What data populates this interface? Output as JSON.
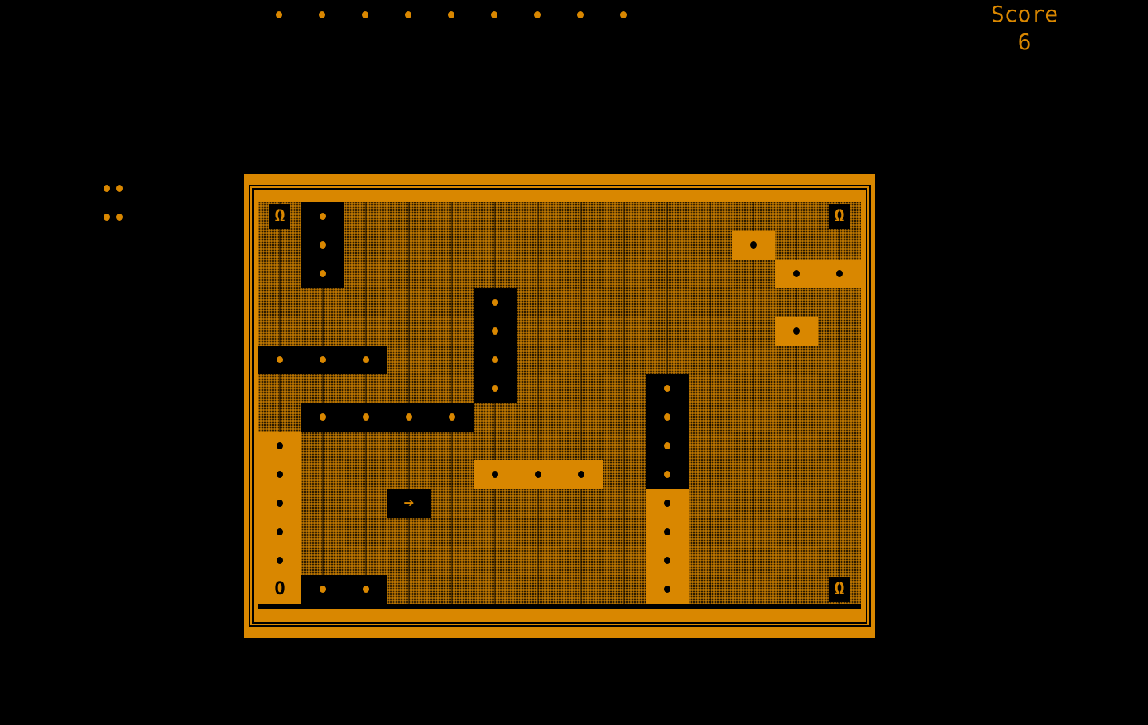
{
  "score": {
    "label": "Score",
    "value": "6"
  },
  "colors": {
    "amber": "#d98700",
    "background": "#000000",
    "fill_dark": "#2a1a00"
  },
  "top_row_dots": 9,
  "lives_remaining": 4,
  "board": {
    "columns": 14,
    "rows": 14,
    "legend": {
      "f": "filled-tile",
      "c": "cleared-path",
      "l": "lit-path"
    },
    "symbols": {
      "dot": "pellet",
      "gate": "Ω",
      "ring": "O",
      "arrow": "➔"
    },
    "tiles": [
      [
        "f",
        "c",
        "f",
        "f",
        "f",
        "f",
        "f",
        "f",
        "f",
        "f",
        "f",
        "f",
        "f",
        "f"
      ],
      [
        "f",
        "c",
        "f",
        "f",
        "f",
        "f",
        "f",
        "f",
        "f",
        "f",
        "f",
        "l",
        "f",
        "f"
      ],
      [
        "f",
        "c",
        "f",
        "f",
        "f",
        "f",
        "f",
        "f",
        "f",
        "f",
        "f",
        "f",
        "l",
        "l"
      ],
      [
        "f",
        "f",
        "f",
        "f",
        "f",
        "c",
        "f",
        "f",
        "f",
        "f",
        "f",
        "f",
        "f",
        "f"
      ],
      [
        "f",
        "f",
        "f",
        "f",
        "f",
        "c",
        "f",
        "f",
        "f",
        "f",
        "f",
        "f",
        "l",
        "f"
      ],
      [
        "c",
        "c",
        "c",
        "f",
        "f",
        "c",
        "f",
        "f",
        "f",
        "f",
        "f",
        "f",
        "f",
        "f"
      ],
      [
        "f",
        "f",
        "f",
        "f",
        "f",
        "c",
        "f",
        "f",
        "f",
        "c",
        "f",
        "f",
        "f",
        "f"
      ],
      [
        "f",
        "c",
        "c",
        "c",
        "c",
        "f",
        "f",
        "f",
        "f",
        "c",
        "f",
        "f",
        "f",
        "f"
      ],
      [
        "l",
        "f",
        "f",
        "f",
        "f",
        "f",
        "f",
        "f",
        "f",
        "c",
        "f",
        "f",
        "f",
        "f"
      ],
      [
        "l",
        "f",
        "f",
        "f",
        "f",
        "l",
        "l",
        "l",
        "f",
        "c",
        "f",
        "f",
        "f",
        "f"
      ],
      [
        "l",
        "f",
        "f",
        "c",
        "f",
        "f",
        "f",
        "f",
        "f",
        "l",
        "f",
        "f",
        "f",
        "f"
      ],
      [
        "l",
        "f",
        "f",
        "f",
        "f",
        "f",
        "f",
        "f",
        "f",
        "l",
        "f",
        "f",
        "f",
        "f"
      ],
      [
        "l",
        "f",
        "f",
        "f",
        "f",
        "f",
        "f",
        "f",
        "f",
        "l",
        "f",
        "f",
        "f",
        "f"
      ],
      [
        "l",
        "c",
        "c",
        "f",
        "f",
        "f",
        "f",
        "f",
        "f",
        "l",
        "f",
        "f",
        "f",
        "f"
      ]
    ],
    "marks": [
      {
        "row": 0,
        "col": 0,
        "type": "gate"
      },
      {
        "row": 0,
        "col": 13,
        "type": "gate"
      },
      {
        "row": 13,
        "col": 13,
        "type": "gate"
      },
      {
        "row": 13,
        "col": 0,
        "type": "ring"
      },
      {
        "row": 10,
        "col": 3,
        "type": "arrow"
      },
      {
        "row": 0,
        "col": 1,
        "type": "dot"
      },
      {
        "row": 1,
        "col": 1,
        "type": "dot"
      },
      {
        "row": 2,
        "col": 1,
        "type": "dot"
      },
      {
        "row": 1,
        "col": 11,
        "type": "dot"
      },
      {
        "row": 2,
        "col": 12,
        "type": "dot"
      },
      {
        "row": 2,
        "col": 13,
        "type": "dot"
      },
      {
        "row": 3,
        "col": 5,
        "type": "dot"
      },
      {
        "row": 4,
        "col": 5,
        "type": "dot"
      },
      {
        "row": 5,
        "col": 5,
        "type": "dot"
      },
      {
        "row": 6,
        "col": 5,
        "type": "dot"
      },
      {
        "row": 4,
        "col": 12,
        "type": "dot"
      },
      {
        "row": 5,
        "col": 0,
        "type": "dot"
      },
      {
        "row": 5,
        "col": 1,
        "type": "dot"
      },
      {
        "row": 5,
        "col": 2,
        "type": "dot"
      },
      {
        "row": 6,
        "col": 9,
        "type": "dot"
      },
      {
        "row": 7,
        "col": 9,
        "type": "dot"
      },
      {
        "row": 8,
        "col": 9,
        "type": "dot"
      },
      {
        "row": 9,
        "col": 9,
        "type": "dot"
      },
      {
        "row": 7,
        "col": 1,
        "type": "dot"
      },
      {
        "row": 7,
        "col": 2,
        "type": "dot"
      },
      {
        "row": 7,
        "col": 3,
        "type": "dot"
      },
      {
        "row": 7,
        "col": 4,
        "type": "dot"
      },
      {
        "row": 8,
        "col": 0,
        "type": "dot"
      },
      {
        "row": 9,
        "col": 0,
        "type": "dot"
      },
      {
        "row": 10,
        "col": 0,
        "type": "dot"
      },
      {
        "row": 11,
        "col": 0,
        "type": "dot"
      },
      {
        "row": 12,
        "col": 0,
        "type": "dot"
      },
      {
        "row": 9,
        "col": 5,
        "type": "dot"
      },
      {
        "row": 9,
        "col": 6,
        "type": "dot"
      },
      {
        "row": 9,
        "col": 7,
        "type": "dot"
      },
      {
        "row": 10,
        "col": 9,
        "type": "dot"
      },
      {
        "row": 11,
        "col": 9,
        "type": "dot"
      },
      {
        "row": 12,
        "col": 9,
        "type": "dot"
      },
      {
        "row": 13,
        "col": 9,
        "type": "dot"
      },
      {
        "row": 13,
        "col": 1,
        "type": "dot"
      },
      {
        "row": 13,
        "col": 2,
        "type": "dot"
      }
    ]
  }
}
